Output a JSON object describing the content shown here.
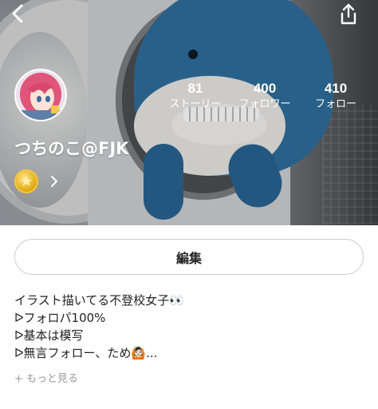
{
  "profile": {
    "username": "つちのこ@FJK",
    "stats": [
      {
        "value": "81",
        "label": "ストーリー"
      },
      {
        "value": "400",
        "label": "フォロワー"
      },
      {
        "value": "410",
        "label": "フォロー"
      }
    ]
  },
  "actions": {
    "edit_label": "編集"
  },
  "bio": {
    "lines": [
      "イラスト描いてる不登校女子👀",
      "ᐅフォロパ100%",
      "ᐅ基本は模写",
      "ᐅ無言フォロー、ため🙆🏻..."
    ],
    "more_label": "+ もっと見る"
  },
  "icons": {
    "back": "chevron-left-icon",
    "share": "share-icon",
    "coin": "coin-badge-icon",
    "chevron": "chevron-right-icon"
  },
  "colors": {
    "header_text": "#ffffff",
    "shark_blue": "#2f6e9c",
    "coin_gold": "#e2a80e",
    "muted_text": "#9a9a9a"
  }
}
